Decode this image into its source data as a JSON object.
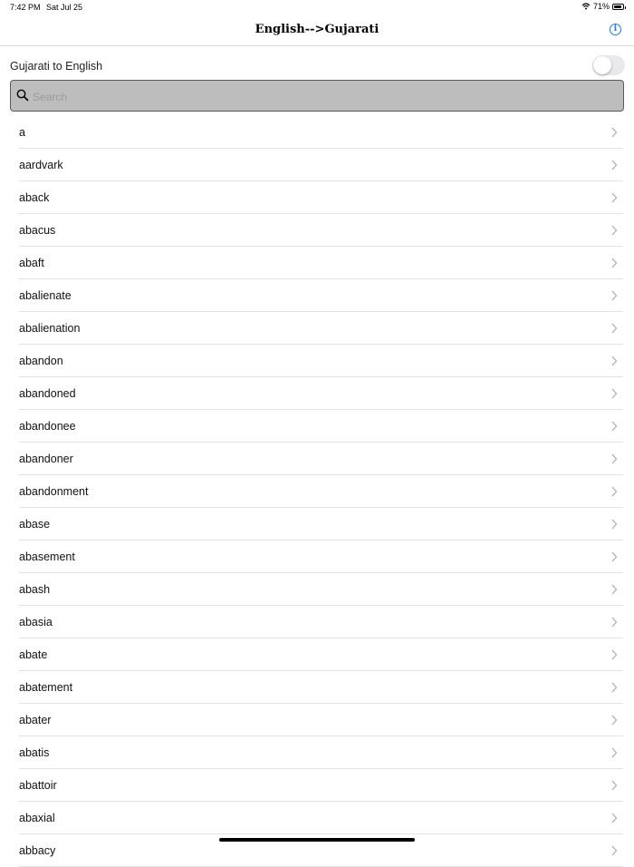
{
  "status_bar": {
    "time": "7:42 PM",
    "date": "Sat Jul 25",
    "battery": "71%"
  },
  "nav": {
    "title": "English-->Gujarati",
    "info_icon": "info-icon"
  },
  "toggle": {
    "label": "Gujarati to English",
    "on": false
  },
  "search": {
    "placeholder": "Search",
    "value": ""
  },
  "words": [
    "a",
    "aardvark",
    "aback",
    "abacus",
    "abaft",
    "abalienate",
    "abalienation",
    "abandon",
    "abandoned",
    "abandonee",
    "abandoner",
    "abandonment",
    "abase",
    "abasement",
    "abash",
    "abasia",
    "abate",
    "abatement",
    "abater",
    "abatis",
    "abattoir",
    "abaxial",
    "abbacy"
  ],
  "colors": {
    "accent": "#1a7ae8",
    "search_bg": "#bdbdbd",
    "separator": "#e3e3e3"
  }
}
